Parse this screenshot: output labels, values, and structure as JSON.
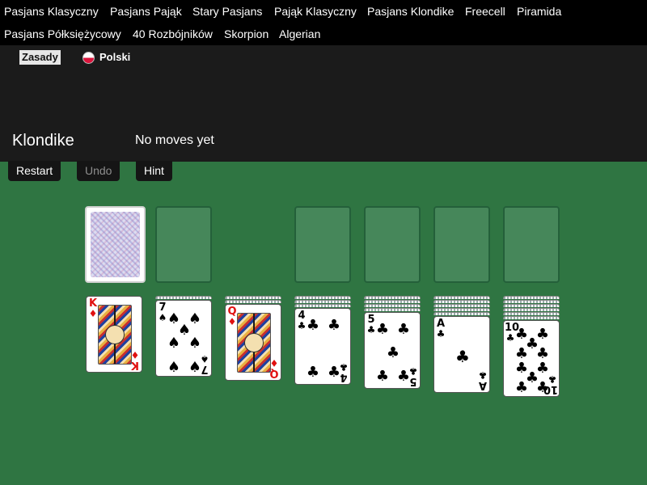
{
  "nav": {
    "row1": [
      "Pasjans Klasyczny",
      "Pasjans Pająk",
      "Stary Pasjans",
      "Pająk Klasyczny",
      "Pasjans Klondike",
      "Freecell",
      "Piramida"
    ],
    "row2": [
      "Pasjans Półksiężycowy",
      "40 Rozbójników",
      "Skorpion",
      "Algerian"
    ]
  },
  "subnav": {
    "rules_label": "Zasady",
    "language_label": "Polski",
    "language_flag_icon": "poland-flag-icon"
  },
  "game": {
    "title": "Klondike",
    "status": "No moves yet"
  },
  "toolbar": {
    "restart_label": "Restart",
    "undo_label": "Undo",
    "undo_disabled": true,
    "hint_label": "Hint"
  },
  "board": {
    "stock": {
      "face": "down"
    },
    "waste": {
      "empty": true
    },
    "foundations": [
      {
        "empty": true
      },
      {
        "empty": true
      },
      {
        "empty": true
      },
      {
        "empty": true
      }
    ],
    "tableau": [
      {
        "hidden": 0,
        "top": {
          "rank": "K",
          "suit": "♦",
          "color": "red"
        }
      },
      {
        "hidden": 1,
        "top": {
          "rank": "7",
          "suit": "♠",
          "color": "black"
        }
      },
      {
        "hidden": 2,
        "top": {
          "rank": "Q",
          "suit": "♦",
          "color": "red"
        }
      },
      {
        "hidden": 3,
        "top": {
          "rank": "4",
          "suit": "♣",
          "color": "black"
        }
      },
      {
        "hidden": 4,
        "top": {
          "rank": "5",
          "suit": "♣",
          "color": "black"
        }
      },
      {
        "hidden": 5,
        "top": {
          "rank": "A",
          "suit": "♣",
          "color": "black"
        }
      },
      {
        "hidden": 6,
        "top": {
          "rank": "10",
          "suit": "♣",
          "color": "black"
        }
      }
    ]
  },
  "colors": {
    "table_green": "#2f7542",
    "header_dark": "#1b1b1b",
    "nav_black": "#000000",
    "card_red": "#e01010"
  }
}
